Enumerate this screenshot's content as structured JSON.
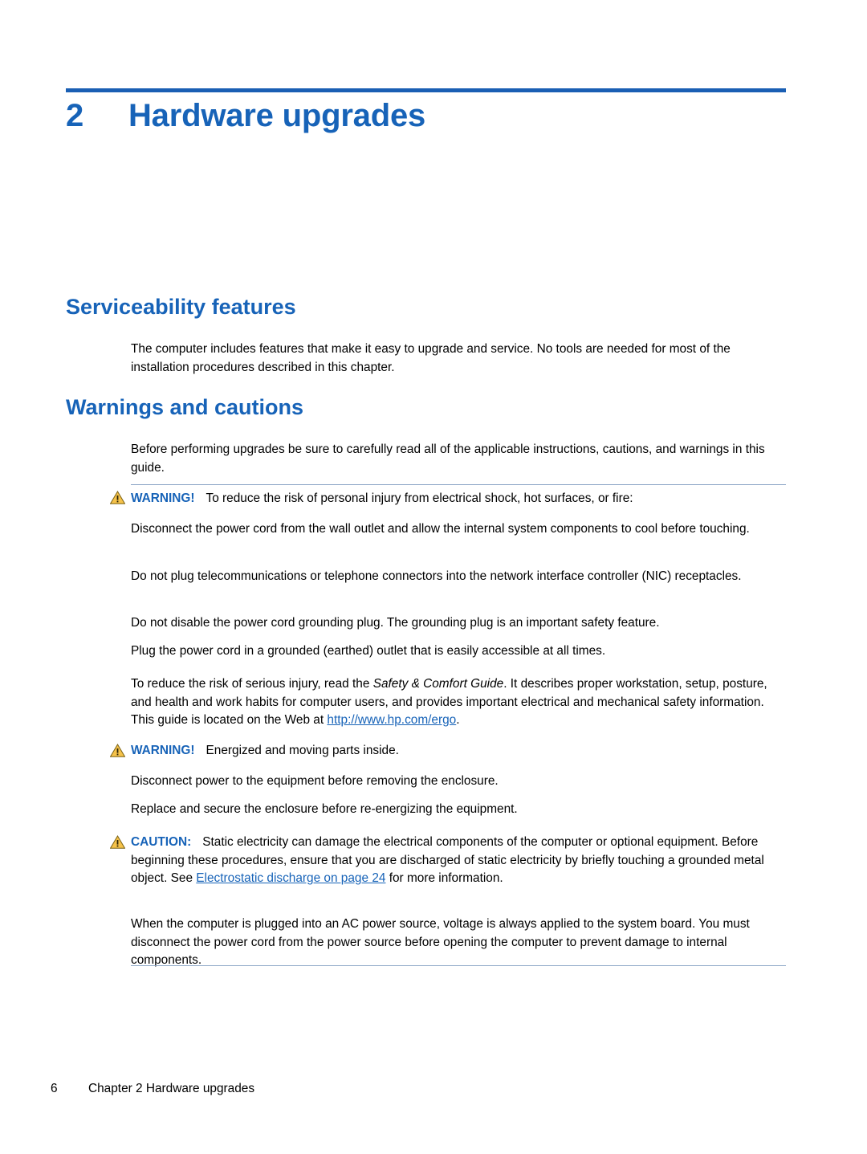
{
  "chapter": {
    "number": "2",
    "title": "Hardware upgrades"
  },
  "sections": {
    "serviceability": {
      "heading": "Serviceability features",
      "paragraph": "The computer includes features that make it easy to upgrade and service. No tools are needed for most of the installation procedures described in this chapter."
    },
    "warnings": {
      "heading": "Warnings and cautions",
      "intro": "Before performing upgrades be sure to carefully read all of the applicable instructions, cautions, and warnings in this guide.",
      "warning1": {
        "label": "WARNING!",
        "text": "To reduce the risk of personal injury from electrical shock, hot surfaces, or fire:",
        "p1": "Disconnect the power cord from the wall outlet and allow the internal system components to cool before touching.",
        "p2": "Do not plug telecommunications or telephone connectors into the network interface controller (NIC) receptacles.",
        "p3": "Do not disable the power cord grounding plug. The grounding plug is an important safety feature.",
        "p4": "Plug the power cord in a grounded (earthed) outlet that is easily accessible at all times.",
        "p5_a": "To reduce the risk of serious injury, read the ",
        "p5_italic": "Safety & Comfort Guide",
        "p5_b": ". It describes proper workstation, setup, posture, and health and work habits for computer users, and provides important electrical and mechanical safety information. This guide is located on the Web at ",
        "p5_link": "http://www.hp.com/ergo",
        "p5_c": "."
      },
      "warning2": {
        "label": "WARNING!",
        "text": "Energized and moving parts inside.",
        "p1": "Disconnect power to the equipment before removing the enclosure.",
        "p2": "Replace and secure the enclosure before re-energizing the equipment."
      },
      "caution": {
        "label": "CAUTION:",
        "text_a": "Static electricity can damage the electrical components of the computer or optional equipment. Before beginning these procedures, ensure that you are discharged of static electricity by briefly touching a grounded metal object. See ",
        "link": "Electrostatic discharge on page 24",
        "text_b": " for more information.",
        "p2": "When the computer is plugged into an AC power source, voltage is always applied to the system board. You must disconnect the power cord from the power source before opening the computer to prevent damage to internal components."
      }
    }
  },
  "footer": {
    "page_number": "6",
    "text": "Chapter 2   Hardware upgrades"
  },
  "colors": {
    "accent": "#1763b8",
    "rule": "#8fa8c8",
    "warning_icon": "#f0a830"
  }
}
